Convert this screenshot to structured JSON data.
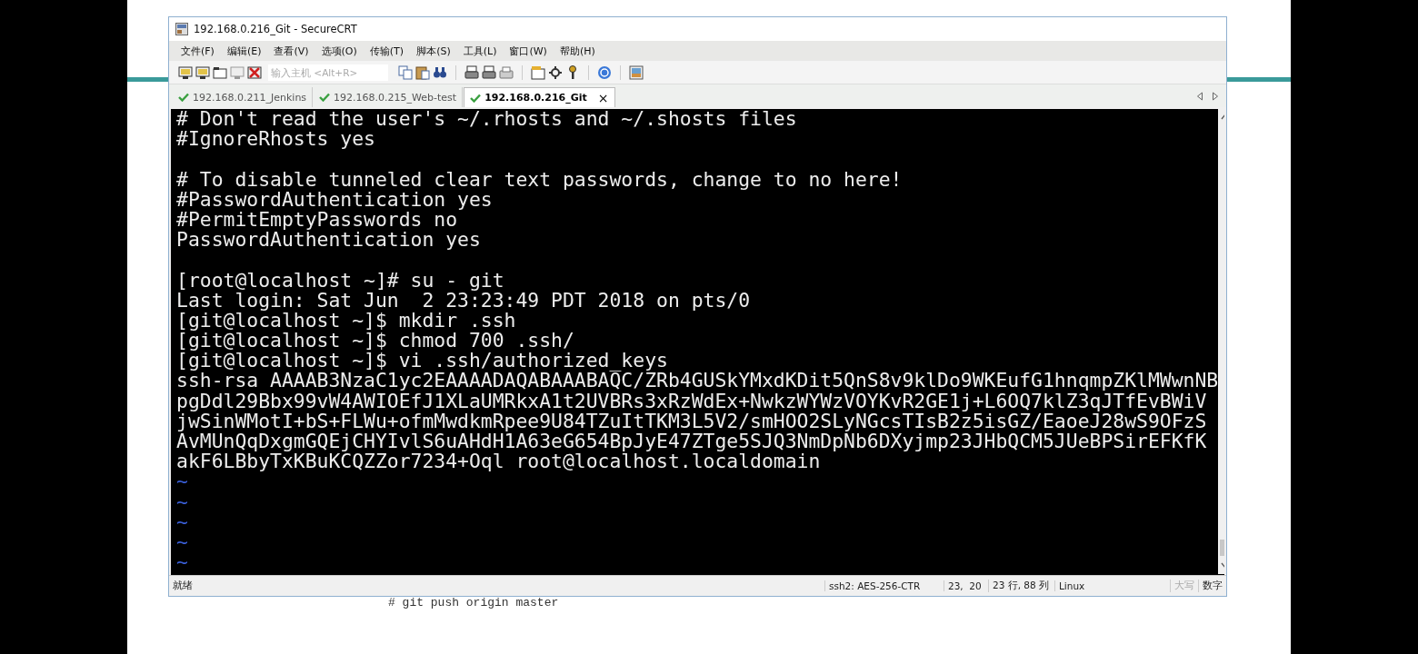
{
  "window": {
    "title": "192.168.0.216_Git - SecureCRT"
  },
  "menu": [
    "文件(F)",
    "编辑(E)",
    "查看(V)",
    "选项(O)",
    "传输(T)",
    "脚本(S)",
    "工具(L)",
    "窗口(W)",
    "帮助(H)"
  ],
  "host_field": {
    "placeholder": "输入主机 <Alt+R>"
  },
  "tabs": [
    {
      "label": "192.168.0.211_Jenkins",
      "selected": false,
      "connected": true
    },
    {
      "label": "192.168.0.215_Web-test",
      "selected": false,
      "connected": true
    },
    {
      "label": "192.168.0.216_Git",
      "selected": true,
      "connected": true
    }
  ],
  "tab_close": "×",
  "terminal": {
    "lines": [
      {
        "kind": "text",
        "text": "# Don't read the user's ~/.rhosts and ~/.shosts files"
      },
      {
        "kind": "text",
        "text": "#IgnoreRhosts yes"
      },
      {
        "kind": "blank"
      },
      {
        "kind": "text",
        "text": "# To disable tunneled clear text passwords, change to no here!"
      },
      {
        "kind": "text",
        "text": "#PasswordAuthentication yes"
      },
      {
        "kind": "text",
        "text": "#PermitEmptyPasswords no"
      },
      {
        "kind": "text",
        "text": "PasswordAuthentication yes"
      },
      {
        "kind": "blank"
      },
      {
        "kind": "text",
        "text": "[root@localhost ~]# su - git"
      },
      {
        "kind": "text",
        "text": "Last login: Sat Jun  2 23:23:49 PDT 2018 on pts/0"
      },
      {
        "kind": "text",
        "text": "[git@localhost ~]$ mkdir .ssh"
      },
      {
        "kind": "text",
        "text": "[git@localhost ~]$ chmod 700 .ssh/"
      },
      {
        "kind": "text",
        "text": "[git@localhost ~]$ vi .ssh/authorized_keys"
      },
      {
        "kind": "text",
        "text": "ssh-rsa AAAAB3NzaC1yc2EAAAADAQABAAABAQC/ZRb4GUSkYMxdKDit5QnS8v9klDo9WKEufG1hnqmpZKlMWwnNB"
      },
      {
        "kind": "text",
        "text": "pgDdl29Bbx99vW4AWIOEfJ1XLaUMRkxA1t2UVBRs3xRzWdEx+NwkzWYWzVOYKvR2GE1j+L6OQ7klZ3qJTfEvBWiV"
      },
      {
        "kind": "text",
        "text": "jwSinWMotI+bS+FLWu+ofmMwdkmRpee9U84TZuItTKM3L5V2/smHOO2SLyNGcsTIsB2z5isGZ/EaoeJ28wS9OFzS"
      },
      {
        "kind": "text",
        "text": "AvMUnQqDxgmGQEjCHYIvlS6uAHdH1A63eG654BpJyE47ZTge5SJQ3NmDpNb6DXyjmp23JHbQCM5JUeBPSirEFKfK"
      },
      {
        "kind": "text",
        "text": "akF6LBbyTxKBuKCQZZor7234+Oql root@localhost.localdomain"
      },
      {
        "kind": "tilde",
        "text": "~"
      },
      {
        "kind": "tilde",
        "text": "~"
      },
      {
        "kind": "tilde",
        "text": "~"
      },
      {
        "kind": "tilde",
        "text": "~"
      },
      {
        "kind": "tilde",
        "text": "~"
      }
    ]
  },
  "status_bar": {
    "message": "就绪",
    "cipher": "ssh2: AES-256-CTR",
    "cursor": "23,  20",
    "size": "23 行, 88 列",
    "terminal_type": "Linux",
    "indicators": [
      {
        "label": "大写",
        "on": false
      },
      {
        "label": "数字",
        "on": true
      }
    ]
  },
  "background_text": "# git push origin master"
}
